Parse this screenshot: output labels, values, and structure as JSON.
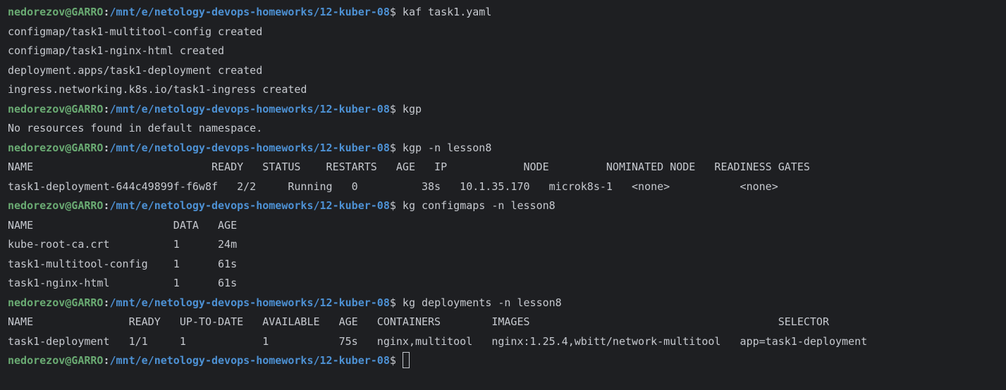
{
  "prompt": {
    "user": "nedorezov@GARRO",
    "separator": ":",
    "path": "/mnt/e/netology-devops-homeworks/12-kuber-08",
    "dollar": "$"
  },
  "lines": [
    {
      "type": "prompt",
      "command": "kaf task1.yaml"
    },
    {
      "type": "output",
      "text": "configmap/task1-multitool-config created"
    },
    {
      "type": "output",
      "text": "configmap/task1-nginx-html created"
    },
    {
      "type": "output",
      "text": "deployment.apps/task1-deployment created"
    },
    {
      "type": "output",
      "text": "ingress.networking.k8s.io/task1-ingress created"
    },
    {
      "type": "prompt",
      "command": "kgp"
    },
    {
      "type": "output",
      "text": "No resources found in default namespace."
    },
    {
      "type": "prompt",
      "command": "kgp -n lesson8"
    },
    {
      "type": "output",
      "text": "NAME                            READY   STATUS    RESTARTS   AGE   IP            NODE         NOMINATED NODE   READINESS GATES"
    },
    {
      "type": "output",
      "text": "task1-deployment-644c49899f-f6w8f   2/2     Running   0          38s   10.1.35.170   microk8s-1   <none>           <none>"
    },
    {
      "type": "prompt",
      "command": "kg configmaps -n lesson8"
    },
    {
      "type": "output",
      "text": "NAME                      DATA   AGE"
    },
    {
      "type": "output",
      "text": "kube-root-ca.crt          1      24m"
    },
    {
      "type": "output",
      "text": "task1-multitool-config    1      61s"
    },
    {
      "type": "output",
      "text": "task1-nginx-html          1      61s"
    },
    {
      "type": "prompt",
      "command": "kg deployments -n lesson8"
    },
    {
      "type": "output",
      "text": "NAME               READY   UP-TO-DATE   AVAILABLE   AGE   CONTAINERS        IMAGES                                       SELECTOR"
    },
    {
      "type": "output",
      "text": "task1-deployment   1/1     1            1           75s   nginx,multitool   nginx:1.25.4,wbitt/network-multitool   app=task1-deployment"
    },
    {
      "type": "prompt",
      "command": ""
    }
  ]
}
